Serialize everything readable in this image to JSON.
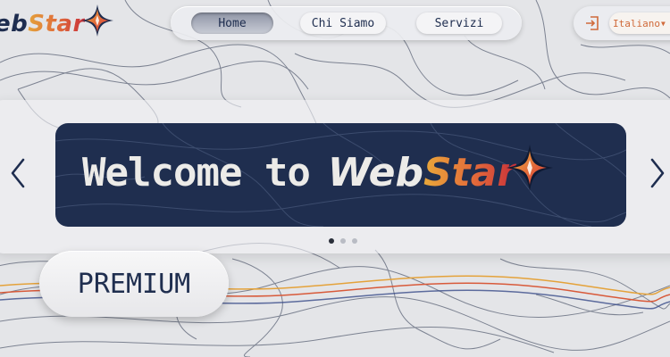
{
  "brand": {
    "logo_prefix": "eb",
    "logo_suffix": "Star",
    "colors": {
      "navy": "#1e2d4f",
      "orange": "#e06a3a",
      "gold": "#e4a23a",
      "red": "#c8303a"
    }
  },
  "nav": {
    "items": [
      {
        "label": "Home",
        "active": true
      },
      {
        "label": "Chi Siamo",
        "active": false
      },
      {
        "label": "Servizi",
        "active": false
      }
    ]
  },
  "header_right": {
    "login_icon": "login-icon",
    "language": "Italiano"
  },
  "carousel": {
    "slide_text": "Welcome to",
    "slide_brand_prefix": "Web",
    "slide_brand_suffix": "Star",
    "slide_count": 3,
    "active_slide": 1,
    "prev_icon": "chevron-left-icon",
    "next_icon": "chevron-right-icon"
  },
  "badge": {
    "label": "PREMIUM"
  }
}
